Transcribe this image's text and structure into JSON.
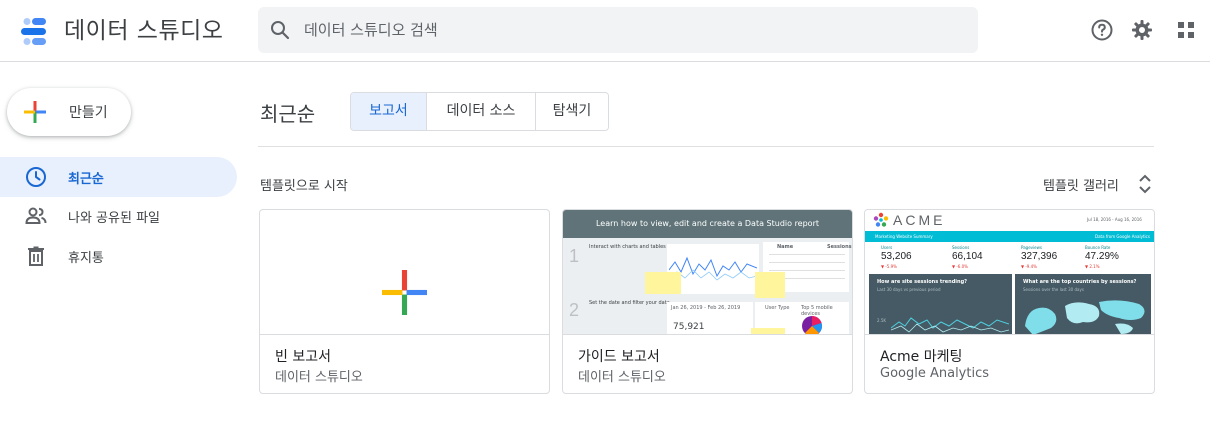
{
  "app": {
    "title": "데이터 스튜디오",
    "logo_icon": "data-studio-logo"
  },
  "search": {
    "placeholder": "데이터 스튜디오 검색",
    "value": "",
    "icon": "search-icon"
  },
  "header_icons": [
    "help-icon",
    "settings-icon",
    "apps-grid-icon"
  ],
  "create": {
    "label": "만들기",
    "icon": "plus-icon"
  },
  "sidebar": {
    "items": [
      {
        "label": "최근순",
        "icon": "clock-icon",
        "active": true
      },
      {
        "label": "나와 공유된 파일",
        "icon": "people-icon",
        "active": false
      },
      {
        "label": "휴지통",
        "icon": "trash-icon",
        "active": false
      }
    ]
  },
  "main": {
    "title": "최근순",
    "tabs": [
      {
        "label": "보고서",
        "active": true
      },
      {
        "label": "데이터 소스",
        "active": false
      },
      {
        "label": "탐색기",
        "active": false
      }
    ],
    "templates_heading": "템플릿으로 시작",
    "gallery_label": "템플릿 갤러리",
    "cards": [
      {
        "name": "빈 보고서",
        "source": "데이터 스튜디오"
      },
      {
        "name": "가이드 보고서",
        "source": "데이터 스튜디오"
      },
      {
        "name": "Acme 마케팅",
        "source": "Google Analytics"
      }
    ]
  },
  "guide_thumb": {
    "banner": "Learn how to view, edit and create a Data Studio report",
    "step1": "1",
    "step1_title": "Interact with charts and tables",
    "step2": "2",
    "step2_title": "Set the date and filter your data",
    "date1": "Jan 26, 2019 - Feb 26, 2019",
    "value": "75,921",
    "table_headers": [
      "Name",
      "Sessions"
    ],
    "legend": "User Type",
    "pie_title": "Top 5 mobile devices"
  },
  "acme_thumb": {
    "brand": "ACME",
    "date": "Jul 18, 2016 - Aug 16, 2016",
    "bar_left": "Marketing Website Summary",
    "bar_right": "Data from Google Analytics",
    "metrics": [
      {
        "label": "Users",
        "value": "53,206",
        "delta": "▼ -5.9%"
      },
      {
        "label": "Sessions",
        "value": "66,104",
        "delta": "▼ -6.0%"
      },
      {
        "label": "Pageviews",
        "value": "327,396",
        "delta": "▼ -9.4%"
      },
      {
        "label": "Bounce Rate",
        "value": "47.29%",
        "delta": "▼ 2.1%"
      }
    ],
    "panel1_title": "How are site sessions trending?",
    "panel1_sub": "Last 30 days vs previous period",
    "panel2_title": "What are the top countries by sessions?",
    "panel2_sub": "Sessions over the last 30 days",
    "axis_tick": "2.5K"
  },
  "colors": {
    "accent_blue": "#1967d2",
    "active_bg": "#e8f0fe",
    "plus_red": "#ea4335",
    "plus_blue": "#4285f4",
    "plus_green": "#34a853",
    "plus_yellow": "#fbbc04"
  }
}
